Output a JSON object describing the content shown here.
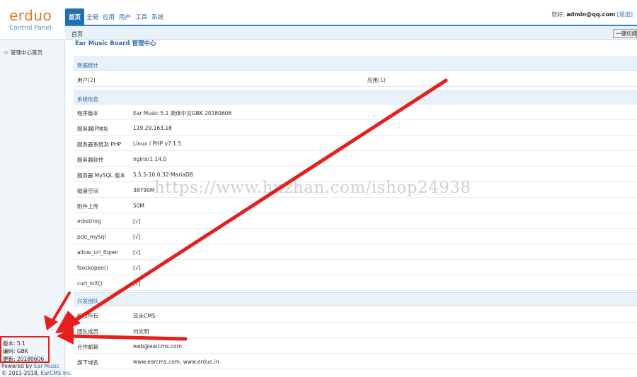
{
  "logo": {
    "main": "erduo",
    "sub": "Control Panel"
  },
  "nav": [
    "首页",
    "全局",
    "应用",
    "用户",
    "工具",
    "系统"
  ],
  "user": {
    "greeting": "您好,",
    "name": "admin@qq.com",
    "logout": "[退出]"
  },
  "breadcrumb": "首页",
  "fast_button": "一键切换",
  "sidebar": {
    "item": "管理中心首页",
    "version": "版本: 5.1",
    "encoding": "编码: GBK",
    "updated": "更新: 20180606",
    "powered_prefix": "Powered by",
    "powered_link": "Ear Music",
    "copyright_prefix": "© 2011-2018,",
    "copyright_link": "EarCMS Inc."
  },
  "main": {
    "title": "Ear Music Board 管理中心",
    "stats_head": "数据统计",
    "stats": {
      "users_label": "用户",
      "users_count": "2",
      "apps_label": "应用",
      "apps_count": "1"
    },
    "sysinfo_head": "系统信息",
    "sysinfo": [
      {
        "k": "程序版本",
        "v": "Ear Music 5.1 简体中文GBK 20180606"
      },
      {
        "k": "服务器IP地址",
        "v": "119.29.163.18"
      },
      {
        "k": "服务器系统及 PHP",
        "v": "Linux / PHP v7.1.5"
      },
      {
        "k": "服务器软件",
        "v": "nginx/1.14.0"
      },
      {
        "k": "服务器 MySQL 版本",
        "v": "5.5.5-10.0.32-MariaDB"
      },
      {
        "k": "磁盘空间",
        "v": "38790M"
      },
      {
        "k": "附件上传",
        "v": "50M"
      },
      {
        "k": "mbstring",
        "v": "[√]"
      },
      {
        "k": "pdo_mysql",
        "v": "[√]"
      },
      {
        "k": "allow_url_fopen",
        "v": "[√]"
      },
      {
        "k": "fsockopen()",
        "v": "[√]"
      },
      {
        "k": "curl_init()",
        "v": "[√]"
      }
    ],
    "team_head": "开发团队",
    "team": [
      {
        "k": "版权所有",
        "v": "耳朵CMS"
      },
      {
        "k": "团队成员",
        "v": "刘文明"
      },
      {
        "k": "合作邮箱",
        "v": "web@earcms.com"
      },
      {
        "k": "旗下域名",
        "v": "www.earcms.com, www.erduo.in"
      }
    ]
  },
  "watermark": "https://www.huzhan.com/ishop24938",
  "colors": {
    "accent": "#1f70b3",
    "arrow": "#e61e1e",
    "link": "#2c68a6"
  }
}
